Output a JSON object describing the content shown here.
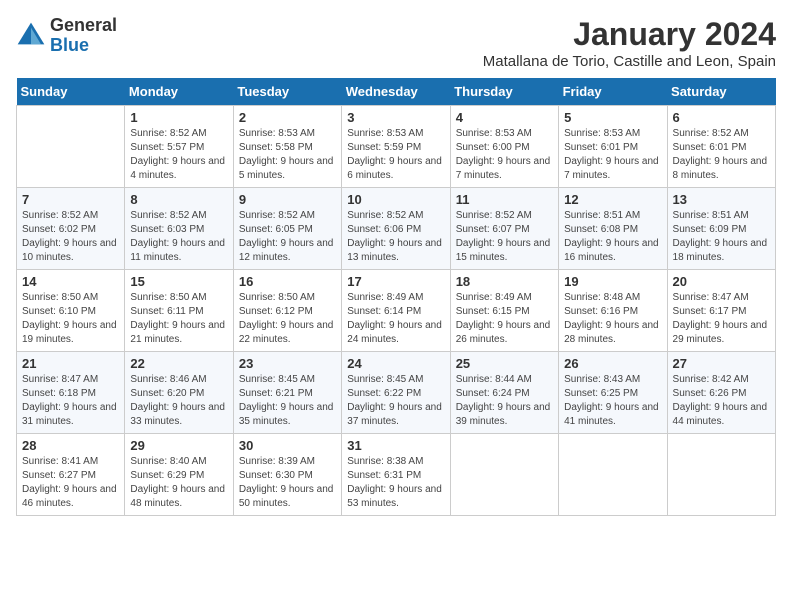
{
  "logo": {
    "line1": "General",
    "line2": "Blue"
  },
  "title": "January 2024",
  "location": "Matallana de Torio, Castille and Leon, Spain",
  "days_of_week": [
    "Sunday",
    "Monday",
    "Tuesday",
    "Wednesday",
    "Thursday",
    "Friday",
    "Saturday"
  ],
  "weeks": [
    [
      {
        "day": "",
        "sunrise": "",
        "sunset": "",
        "daylight": ""
      },
      {
        "day": "1",
        "sunrise": "Sunrise: 8:52 AM",
        "sunset": "Sunset: 5:57 PM",
        "daylight": "Daylight: 9 hours and 4 minutes."
      },
      {
        "day": "2",
        "sunrise": "Sunrise: 8:53 AM",
        "sunset": "Sunset: 5:58 PM",
        "daylight": "Daylight: 9 hours and 5 minutes."
      },
      {
        "day": "3",
        "sunrise": "Sunrise: 8:53 AM",
        "sunset": "Sunset: 5:59 PM",
        "daylight": "Daylight: 9 hours and 6 minutes."
      },
      {
        "day": "4",
        "sunrise": "Sunrise: 8:53 AM",
        "sunset": "Sunset: 6:00 PM",
        "daylight": "Daylight: 9 hours and 7 minutes."
      },
      {
        "day": "5",
        "sunrise": "Sunrise: 8:53 AM",
        "sunset": "Sunset: 6:01 PM",
        "daylight": "Daylight: 9 hours and 7 minutes."
      },
      {
        "day": "6",
        "sunrise": "Sunrise: 8:52 AM",
        "sunset": "Sunset: 6:01 PM",
        "daylight": "Daylight: 9 hours and 8 minutes."
      }
    ],
    [
      {
        "day": "7",
        "sunrise": "Sunrise: 8:52 AM",
        "sunset": "Sunset: 6:02 PM",
        "daylight": "Daylight: 9 hours and 10 minutes."
      },
      {
        "day": "8",
        "sunrise": "Sunrise: 8:52 AM",
        "sunset": "Sunset: 6:03 PM",
        "daylight": "Daylight: 9 hours and 11 minutes."
      },
      {
        "day": "9",
        "sunrise": "Sunrise: 8:52 AM",
        "sunset": "Sunset: 6:05 PM",
        "daylight": "Daylight: 9 hours and 12 minutes."
      },
      {
        "day": "10",
        "sunrise": "Sunrise: 8:52 AM",
        "sunset": "Sunset: 6:06 PM",
        "daylight": "Daylight: 9 hours and 13 minutes."
      },
      {
        "day": "11",
        "sunrise": "Sunrise: 8:52 AM",
        "sunset": "Sunset: 6:07 PM",
        "daylight": "Daylight: 9 hours and 15 minutes."
      },
      {
        "day": "12",
        "sunrise": "Sunrise: 8:51 AM",
        "sunset": "Sunset: 6:08 PM",
        "daylight": "Daylight: 9 hours and 16 minutes."
      },
      {
        "day": "13",
        "sunrise": "Sunrise: 8:51 AM",
        "sunset": "Sunset: 6:09 PM",
        "daylight": "Daylight: 9 hours and 18 minutes."
      }
    ],
    [
      {
        "day": "14",
        "sunrise": "Sunrise: 8:50 AM",
        "sunset": "Sunset: 6:10 PM",
        "daylight": "Daylight: 9 hours and 19 minutes."
      },
      {
        "day": "15",
        "sunrise": "Sunrise: 8:50 AM",
        "sunset": "Sunset: 6:11 PM",
        "daylight": "Daylight: 9 hours and 21 minutes."
      },
      {
        "day": "16",
        "sunrise": "Sunrise: 8:50 AM",
        "sunset": "Sunset: 6:12 PM",
        "daylight": "Daylight: 9 hours and 22 minutes."
      },
      {
        "day": "17",
        "sunrise": "Sunrise: 8:49 AM",
        "sunset": "Sunset: 6:14 PM",
        "daylight": "Daylight: 9 hours and 24 minutes."
      },
      {
        "day": "18",
        "sunrise": "Sunrise: 8:49 AM",
        "sunset": "Sunset: 6:15 PM",
        "daylight": "Daylight: 9 hours and 26 minutes."
      },
      {
        "day": "19",
        "sunrise": "Sunrise: 8:48 AM",
        "sunset": "Sunset: 6:16 PM",
        "daylight": "Daylight: 9 hours and 28 minutes."
      },
      {
        "day": "20",
        "sunrise": "Sunrise: 8:47 AM",
        "sunset": "Sunset: 6:17 PM",
        "daylight": "Daylight: 9 hours and 29 minutes."
      }
    ],
    [
      {
        "day": "21",
        "sunrise": "Sunrise: 8:47 AM",
        "sunset": "Sunset: 6:18 PM",
        "daylight": "Daylight: 9 hours and 31 minutes."
      },
      {
        "day": "22",
        "sunrise": "Sunrise: 8:46 AM",
        "sunset": "Sunset: 6:20 PM",
        "daylight": "Daylight: 9 hours and 33 minutes."
      },
      {
        "day": "23",
        "sunrise": "Sunrise: 8:45 AM",
        "sunset": "Sunset: 6:21 PM",
        "daylight": "Daylight: 9 hours and 35 minutes."
      },
      {
        "day": "24",
        "sunrise": "Sunrise: 8:45 AM",
        "sunset": "Sunset: 6:22 PM",
        "daylight": "Daylight: 9 hours and 37 minutes."
      },
      {
        "day": "25",
        "sunrise": "Sunrise: 8:44 AM",
        "sunset": "Sunset: 6:24 PM",
        "daylight": "Daylight: 9 hours and 39 minutes."
      },
      {
        "day": "26",
        "sunrise": "Sunrise: 8:43 AM",
        "sunset": "Sunset: 6:25 PM",
        "daylight": "Daylight: 9 hours and 41 minutes."
      },
      {
        "day": "27",
        "sunrise": "Sunrise: 8:42 AM",
        "sunset": "Sunset: 6:26 PM",
        "daylight": "Daylight: 9 hours and 44 minutes."
      }
    ],
    [
      {
        "day": "28",
        "sunrise": "Sunrise: 8:41 AM",
        "sunset": "Sunset: 6:27 PM",
        "daylight": "Daylight: 9 hours and 46 minutes."
      },
      {
        "day": "29",
        "sunrise": "Sunrise: 8:40 AM",
        "sunset": "Sunset: 6:29 PM",
        "daylight": "Daylight: 9 hours and 48 minutes."
      },
      {
        "day": "30",
        "sunrise": "Sunrise: 8:39 AM",
        "sunset": "Sunset: 6:30 PM",
        "daylight": "Daylight: 9 hours and 50 minutes."
      },
      {
        "day": "31",
        "sunrise": "Sunrise: 8:38 AM",
        "sunset": "Sunset: 6:31 PM",
        "daylight": "Daylight: 9 hours and 53 minutes."
      },
      {
        "day": "",
        "sunrise": "",
        "sunset": "",
        "daylight": ""
      },
      {
        "day": "",
        "sunrise": "",
        "sunset": "",
        "daylight": ""
      },
      {
        "day": "",
        "sunrise": "",
        "sunset": "",
        "daylight": ""
      }
    ]
  ]
}
